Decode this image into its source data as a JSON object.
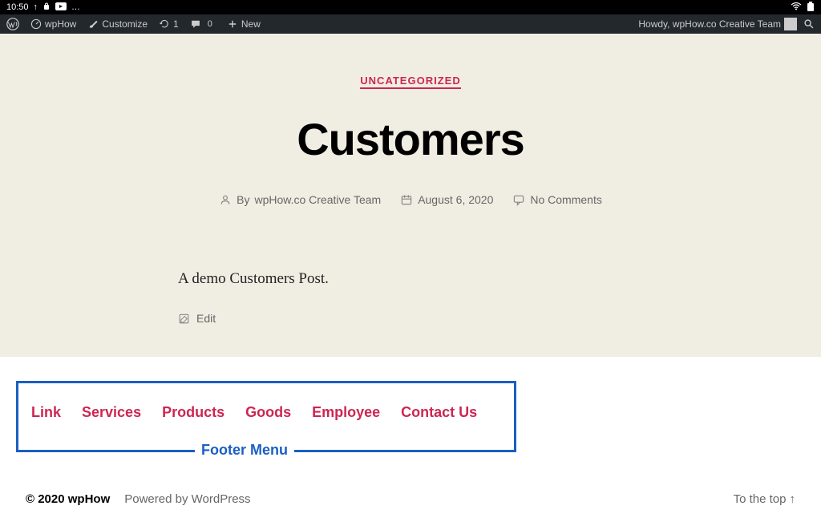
{
  "device": {
    "time": "10:50"
  },
  "adminbar": {
    "site_name": "wpHow",
    "customize": "Customize",
    "updates": "1",
    "comments": "0",
    "new": "New",
    "howdy": "Howdy, wpHow.co Creative Team"
  },
  "post": {
    "category": "UNCATEGORIZED",
    "title": "Customers",
    "author_prefix": "By",
    "author": "wpHow.co Creative Team",
    "date": "August 6, 2020",
    "comments": "No Comments",
    "body": "A demo Customers Post.",
    "edit": "Edit"
  },
  "footermenu": {
    "label": "Footer Menu",
    "items": [
      "Link",
      "Services",
      "Products",
      "Goods",
      "Employee",
      "Contact Us"
    ]
  },
  "footer": {
    "copyright": "© 2020 wpHow",
    "powered": "Powered by WordPress",
    "to_top": "To the top"
  }
}
